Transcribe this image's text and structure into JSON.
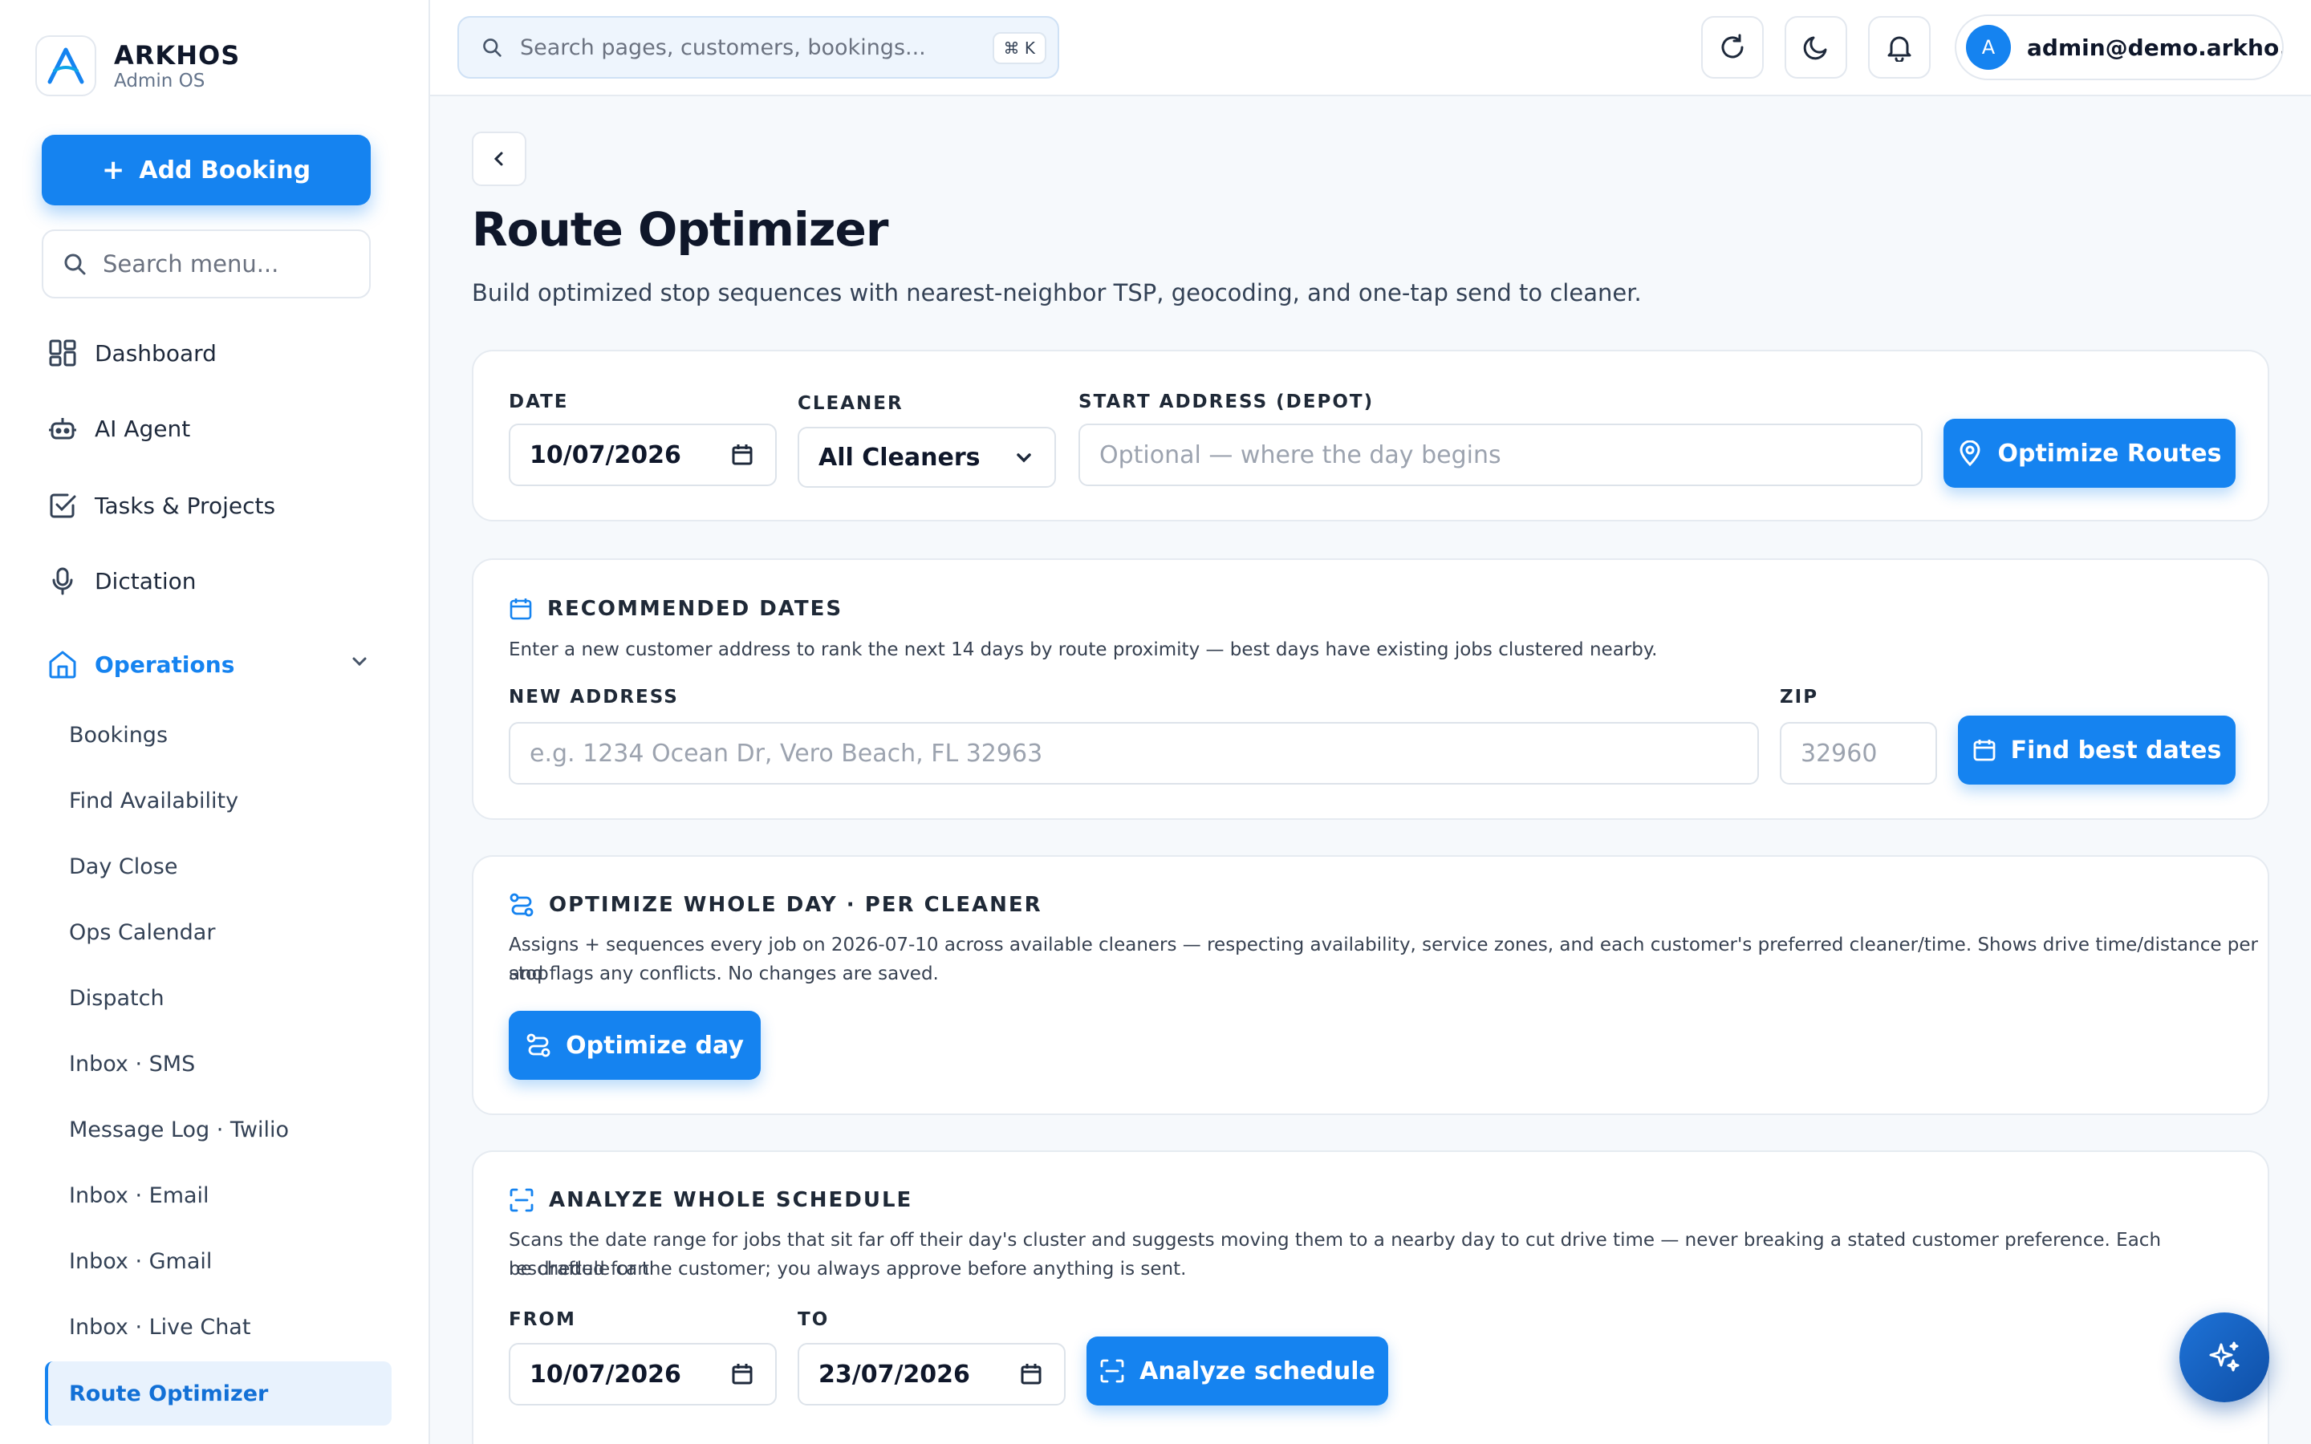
{
  "brand": {
    "name": "ARKHOS",
    "subtitle": "Admin OS"
  },
  "sidebar": {
    "add_booking_label": "Add Booking",
    "search_placeholder": "Search menu...",
    "nav": [
      {
        "label": "Dashboard",
        "icon": "grid-icon"
      },
      {
        "label": "AI Agent",
        "icon": "robot-icon"
      },
      {
        "label": "Tasks & Projects",
        "icon": "checkbox-icon"
      },
      {
        "label": "Dictation",
        "icon": "microphone-icon"
      }
    ],
    "group": {
      "label": "Operations",
      "icon": "home-icon",
      "expanded": true
    },
    "sub_items": [
      "Bookings",
      "Find Availability",
      "Day Close",
      "Ops Calendar",
      "Dispatch",
      "Inbox · SMS",
      "Message Log · Twilio",
      "Inbox · Email",
      "Inbox · Gmail",
      "Inbox · Live Chat",
      "Route Optimizer"
    ],
    "active_item": "Route Optimizer"
  },
  "topbar": {
    "search_placeholder": "Search pages, customers, bookings...",
    "shortcut": "⌘ K",
    "user_initial": "A",
    "user_email": "admin@demo.arkho..."
  },
  "page": {
    "title": "Route Optimizer",
    "subtitle": "Build optimized stop sequences with nearest-neighbor TSP, geocoding, and one-tap send to cleaner."
  },
  "route_form": {
    "date_label": "DATE",
    "date_value": "10/07/2026",
    "cleaner_label": "CLEANER",
    "cleaner_value": "All Cleaners",
    "start_label": "START ADDRESS (DEPOT)",
    "start_placeholder": "Optional — where the day begins",
    "button_label": "Optimize Routes"
  },
  "recommended": {
    "title": "RECOMMENDED DATES",
    "description": "Enter a new customer address to rank the next 14 days by route proximity — best days have existing jobs clustered nearby.",
    "address_label": "NEW ADDRESS",
    "address_placeholder": "e.g. 1234 Ocean Dr, Vero Beach, FL 32963",
    "zip_label": "ZIP",
    "zip_placeholder": "32960",
    "button_label": "Find best dates"
  },
  "whole_day": {
    "title": "OPTIMIZE WHOLE DAY · PER CLEANER",
    "description_line1": "Assigns + sequences every job on 2026-07-10 across available cleaners — respecting availability, service zones, and each customer's preferred cleaner/time. Shows drive time/distance per stop",
    "description_line2": "and flags any conflicts. No changes are saved.",
    "button_label": "Optimize day"
  },
  "schedule": {
    "title": "ANALYZE WHOLE SCHEDULE",
    "description_line1": "Scans the date range for jobs that sit far off their day's cluster and suggests moving them to a nearby day to cut drive time — never breaking a stated customer preference. Each reschedule can",
    "description_line2": "be drafted for the customer; you always approve before anything is sent.",
    "from_label": "FROM",
    "from_value": "10/07/2026",
    "to_label": "TO",
    "to_value": "23/07/2026",
    "button_label": "Analyze schedule"
  },
  "colors": {
    "accent": "#1583f0",
    "active_bg": "#e8f2fd",
    "border": "#e6ebf1"
  }
}
